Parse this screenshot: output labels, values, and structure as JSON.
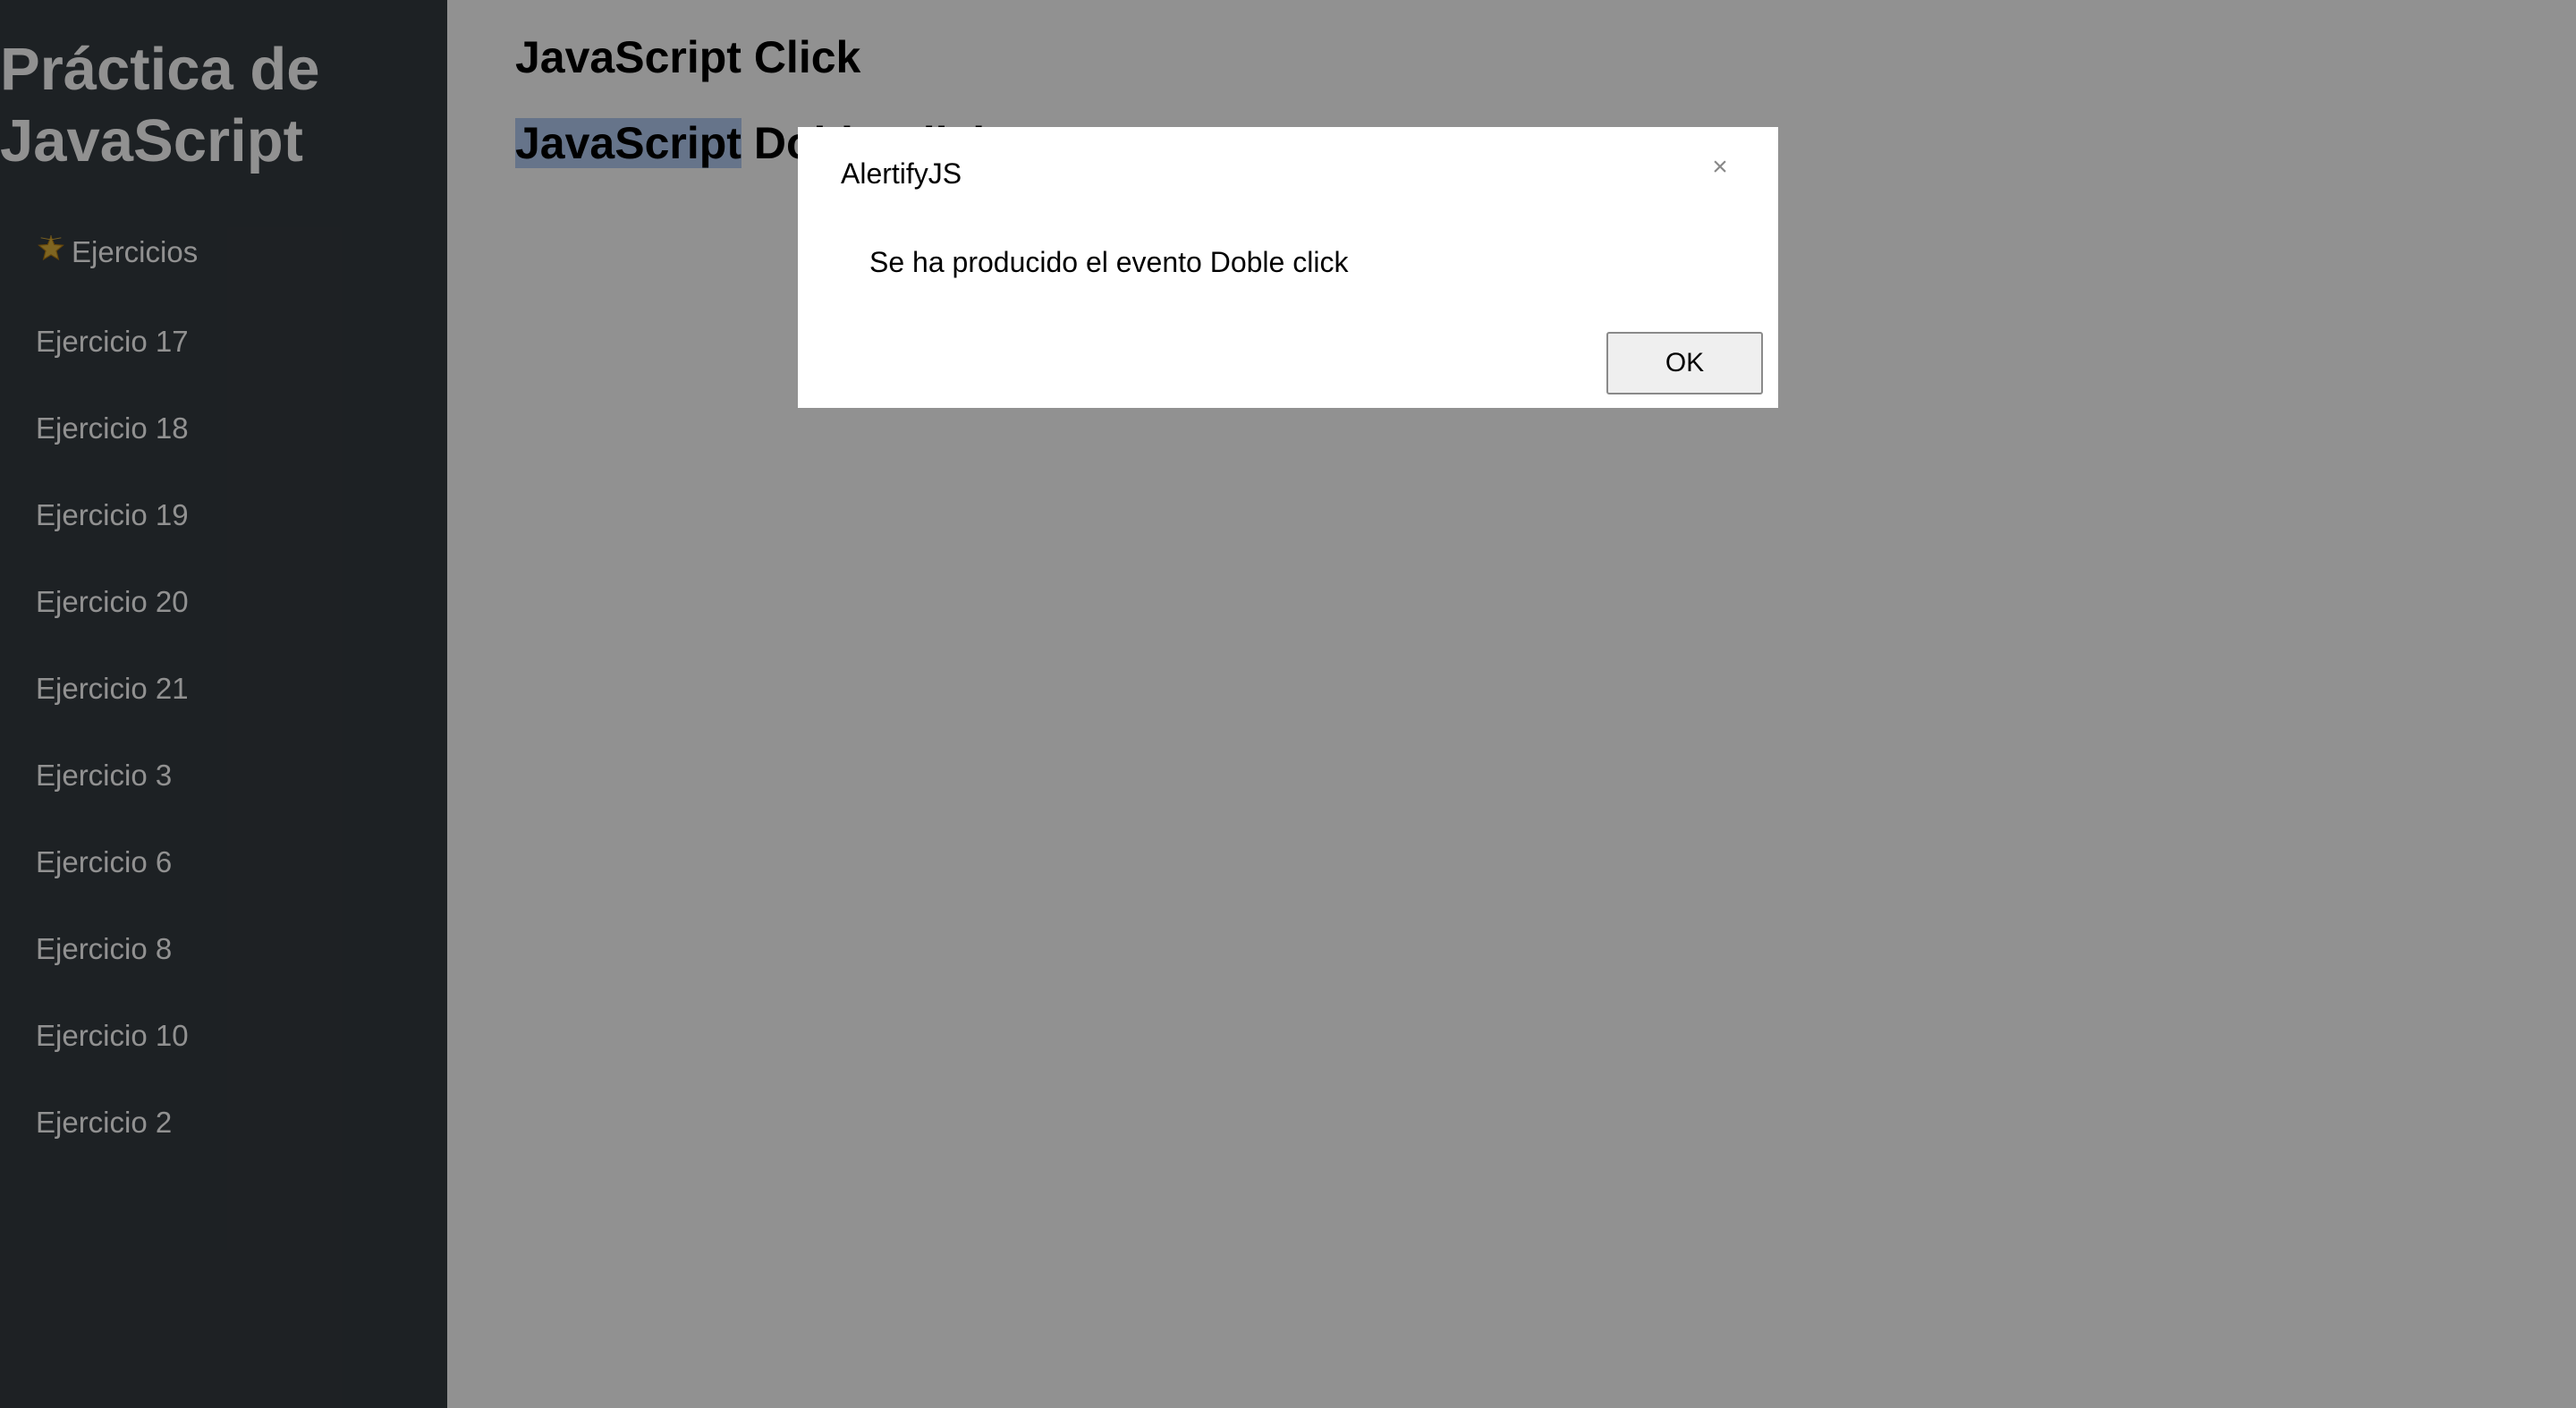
{
  "sidebar": {
    "title_line1": "Práctica de",
    "title_line2": "JavaScript",
    "section_label": "Ejercicios",
    "items": [
      {
        "label": "Ejercicio 17"
      },
      {
        "label": "Ejercicio 18"
      },
      {
        "label": "Ejercicio 19"
      },
      {
        "label": "Ejercicio 20"
      },
      {
        "label": "Ejercicio 21"
      },
      {
        "label": "Ejercicio 3"
      },
      {
        "label": "Ejercicio 6"
      },
      {
        "label": "Ejercicio 8"
      },
      {
        "label": "Ejercicio 10"
      },
      {
        "label": "Ejercicio 2"
      }
    ]
  },
  "main": {
    "heading_click": "JavaScript Click",
    "heading_dblclick_selected": "JavaScript",
    "heading_dblclick_rest": " Doble Click"
  },
  "dialog": {
    "title": "AlertifyJS",
    "close_symbol": "×",
    "message": "Se ha producido el evento Doble click",
    "ok_label": "OK"
  },
  "colors": {
    "sidebar_bg": "#343a40",
    "selection": "#b4cdf2",
    "overlay": "rgba(0,0,0,0.43)"
  }
}
